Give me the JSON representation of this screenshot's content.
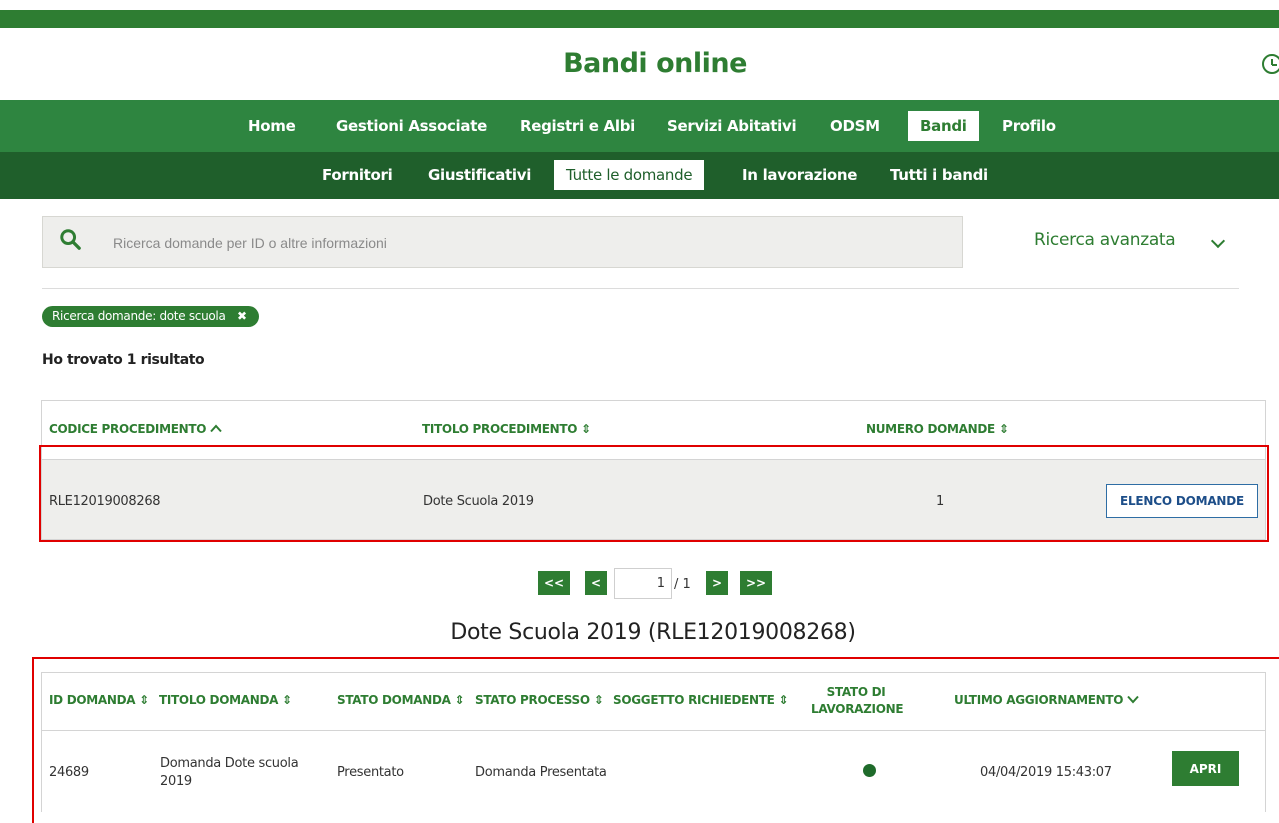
{
  "header": {
    "site_title": "Bandi online"
  },
  "nav_main": {
    "items": [
      {
        "label": "Home"
      },
      {
        "label": "Gestioni Associate"
      },
      {
        "label": "Registri e Albi"
      },
      {
        "label": "Servizi Abitativi"
      },
      {
        "label": "ODSM"
      },
      {
        "label": "Bandi",
        "active": true
      },
      {
        "label": "Profilo"
      }
    ]
  },
  "nav_sub": {
    "items": [
      {
        "label": "Fornitori"
      },
      {
        "label": "Giustificativi"
      },
      {
        "label": "Tutte le domande",
        "active": true
      },
      {
        "label": "In lavorazione"
      },
      {
        "label": "Tutti i bandi"
      }
    ]
  },
  "search": {
    "placeholder": "Ricerca domande per ID o altre informazioni",
    "value": "",
    "advanced_label": "Ricerca avanzata"
  },
  "filter": {
    "chip_label": "Ricerca domande: dote scuola",
    "remove_glyph": "✖"
  },
  "results": {
    "count_text": "Ho trovato 1 risultato"
  },
  "procedures_table": {
    "columns": [
      {
        "label": "CODICE PROCEDIMENTO",
        "sort": "^"
      },
      {
        "label": "TITOLO PROCEDIMENTO",
        "sort": "⇕"
      },
      {
        "label": "NUMERO DOMANDE",
        "sort": "⇕"
      }
    ],
    "rows": [
      {
        "codice": "RLE12019008268",
        "titolo": "Dote Scuola 2019",
        "numero": "1",
        "action_label": "ELENCO DOMANDE"
      }
    ]
  },
  "pagination": {
    "first": "<<",
    "prev": "<",
    "current": "1",
    "total": "/ 1",
    "next": ">",
    "last": ">>"
  },
  "detail": {
    "title": "Dote Scuola 2019 (RLE12019008268)",
    "columns": [
      {
        "label": "ID DOMANDA",
        "sort": "⇕"
      },
      {
        "label": "TITOLO DOMANDA",
        "sort": "⇕"
      },
      {
        "label": "STATO DOMANDA",
        "sort": "⇕"
      },
      {
        "label": "STATO PROCESSO",
        "sort": "⇕"
      },
      {
        "label": "SOGGETTO RICHIEDENTE",
        "sort": "⇕"
      },
      {
        "label": "STATO DI LAVORAZIONE"
      },
      {
        "label": "ULTIMO AGGIORNAMENTO",
        "sort": "⌄"
      }
    ],
    "rows": [
      {
        "id": "24689",
        "titolo": "Domanda Dote scuola 2019",
        "stato_domanda": "Presentato",
        "stato_processo": "Domanda Presentata",
        "soggetto": "",
        "ultimo_aggiornamento": "04/04/2019 15:43:07",
        "action_label": "APRI"
      }
    ]
  },
  "colors": {
    "primary_green": "#2e7d32",
    "nav_green": "#2e8540",
    "subnav_green": "#1f5f2b",
    "highlight_red": "#e00000"
  }
}
